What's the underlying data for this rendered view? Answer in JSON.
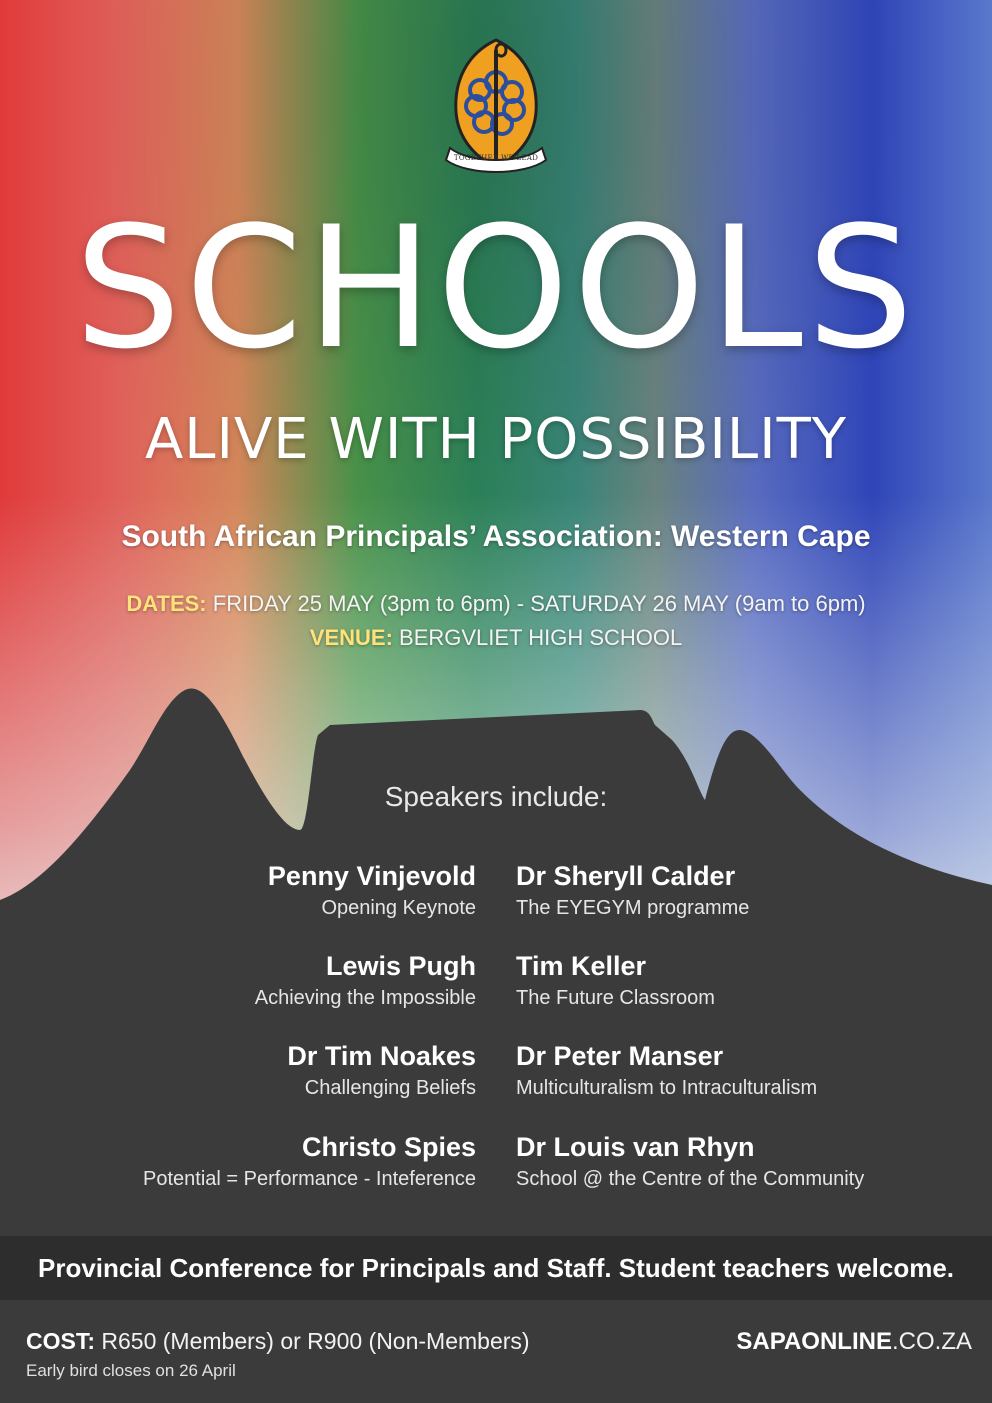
{
  "crest": {
    "motto": "TOGETHER WE LEAD"
  },
  "title": "SCHOOLS",
  "subtitle": "ALIVE WITH POSSIBILITY",
  "association": "South African Principals’ Association: Western Cape",
  "dates": {
    "label": "DATES:",
    "value": "FRIDAY 25 MAY  (3pm to 6pm) - SATURDAY 26 MAY  (9am to 6pm)"
  },
  "venue": {
    "label": "VENUE:",
    "value": "BERGVLIET HIGH SCHOOL"
  },
  "speakers": {
    "heading": "Speakers include:",
    "left": [
      {
        "name": "Penny Vinjevold",
        "topic": "Opening Keynote"
      },
      {
        "name": "Lewis Pugh",
        "topic": "Achieving the Impossible"
      },
      {
        "name": "Dr Tim Noakes",
        "topic": "Challenging Beliefs"
      },
      {
        "name": "Christo Spies",
        "topic": "Potential = Performance - Inteference"
      }
    ],
    "right": [
      {
        "name": "Dr Sheryll Calder",
        "topic": "The EYEGYM programme"
      },
      {
        "name": "Tim Keller",
        "topic": "The Future Classroom"
      },
      {
        "name": "Dr Peter Manser",
        "topic": "Multiculturalism to Intraculturalism"
      },
      {
        "name": "Dr Louis van Rhyn",
        "topic": "School @ the Centre of the Community"
      }
    ]
  },
  "banner": "Provincial Conference for Principals and Staff.  Student teachers welcome.",
  "footer": {
    "cost_label": "COST:",
    "cost_value": "R650 (Members) or R900 (Non-Members)",
    "early_bird": "Early bird closes on 26 April",
    "website_bold": "SAPAONLINE",
    "website_rest": ".CO.ZA"
  },
  "colors": {
    "dark_gray": "#3b3b3b",
    "banner_gray": "#2d2d2d",
    "label_yellow": "#ffe27a",
    "crest_orange": "#f0a020",
    "crest_blue": "#2c4e9c"
  }
}
